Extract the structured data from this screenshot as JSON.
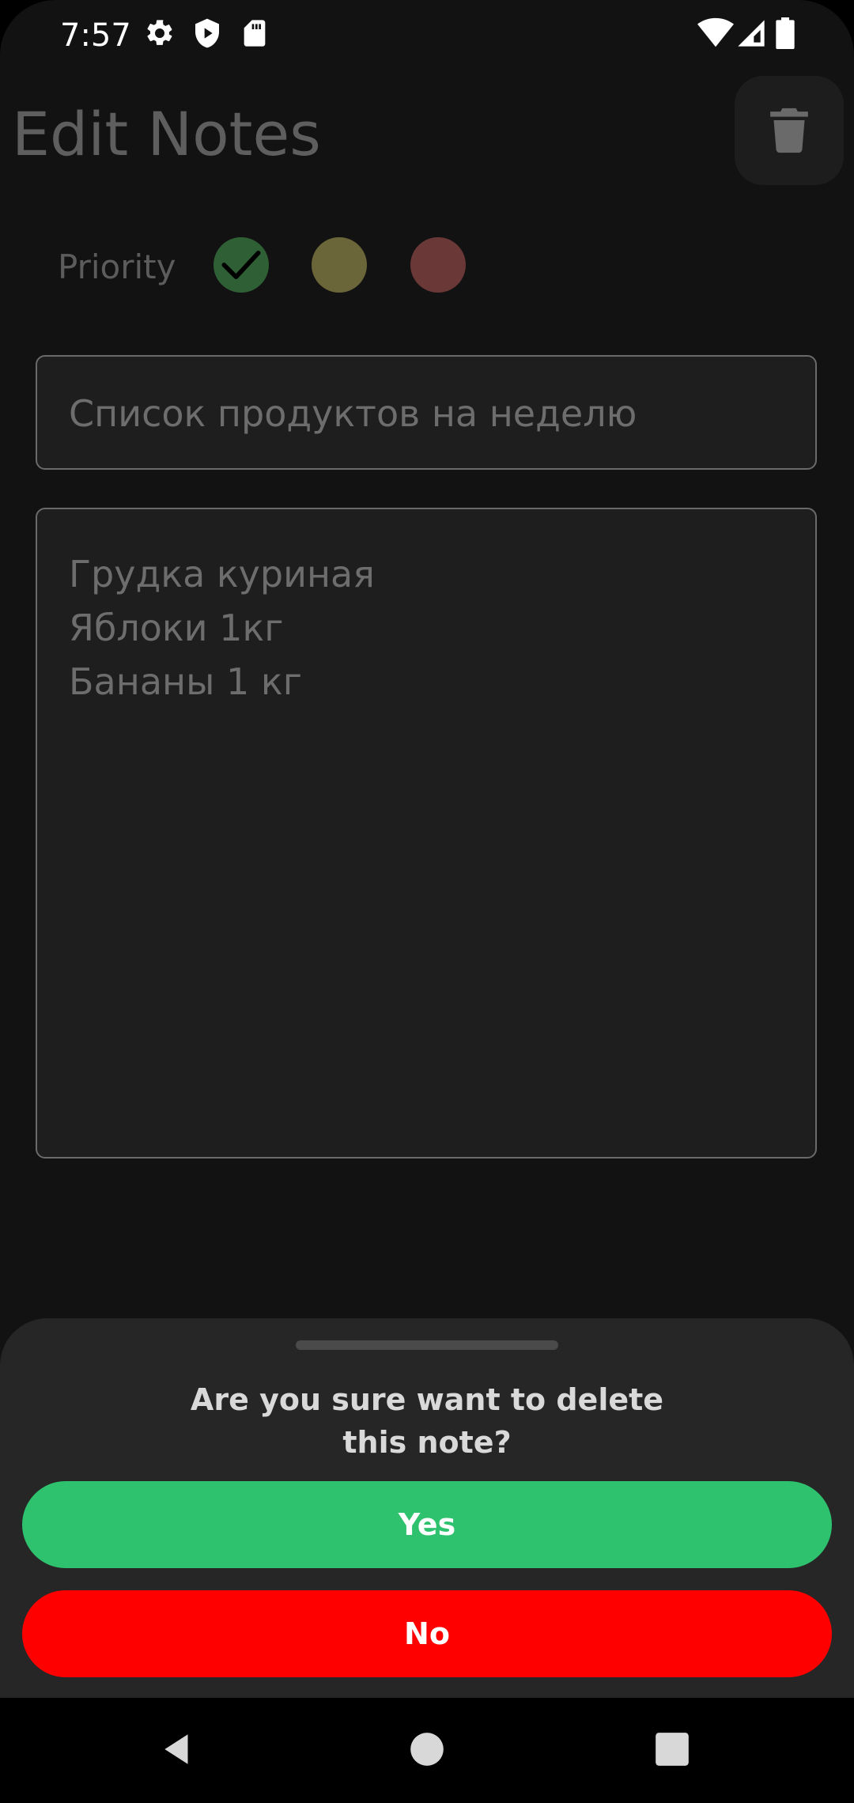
{
  "status_bar": {
    "time": "7:57",
    "left_icons": [
      "settings-icon",
      "shield-play-icon",
      "sd-card-icon"
    ],
    "right_icons": [
      "wifi-icon",
      "signal-icon",
      "battery-icon"
    ]
  },
  "header": {
    "title": "Edit Notes",
    "delete_icon": "trash-icon"
  },
  "priority": {
    "label": "Priority",
    "options": [
      {
        "level": "low",
        "color": "#2f5f34",
        "selected": true
      },
      {
        "level": "medium",
        "color": "#6b6639",
        "selected": false
      },
      {
        "level": "high",
        "color": "#6b3838",
        "selected": false
      }
    ]
  },
  "note": {
    "title_value": "Список продуктов на неделю",
    "body_lines": [
      "Грудка куриная",
      "Яблоки 1кг",
      "Бананы 1 кг"
    ]
  },
  "dialog": {
    "question_line1": "Are you sure want to delete",
    "question_line2": "this note?",
    "yes_label": "Yes",
    "no_label": "No",
    "yes_color": "#2ec26e",
    "no_color": "#ff0000"
  },
  "nav_bar": {
    "icons": [
      "back-icon",
      "home-icon",
      "recents-icon"
    ]
  }
}
